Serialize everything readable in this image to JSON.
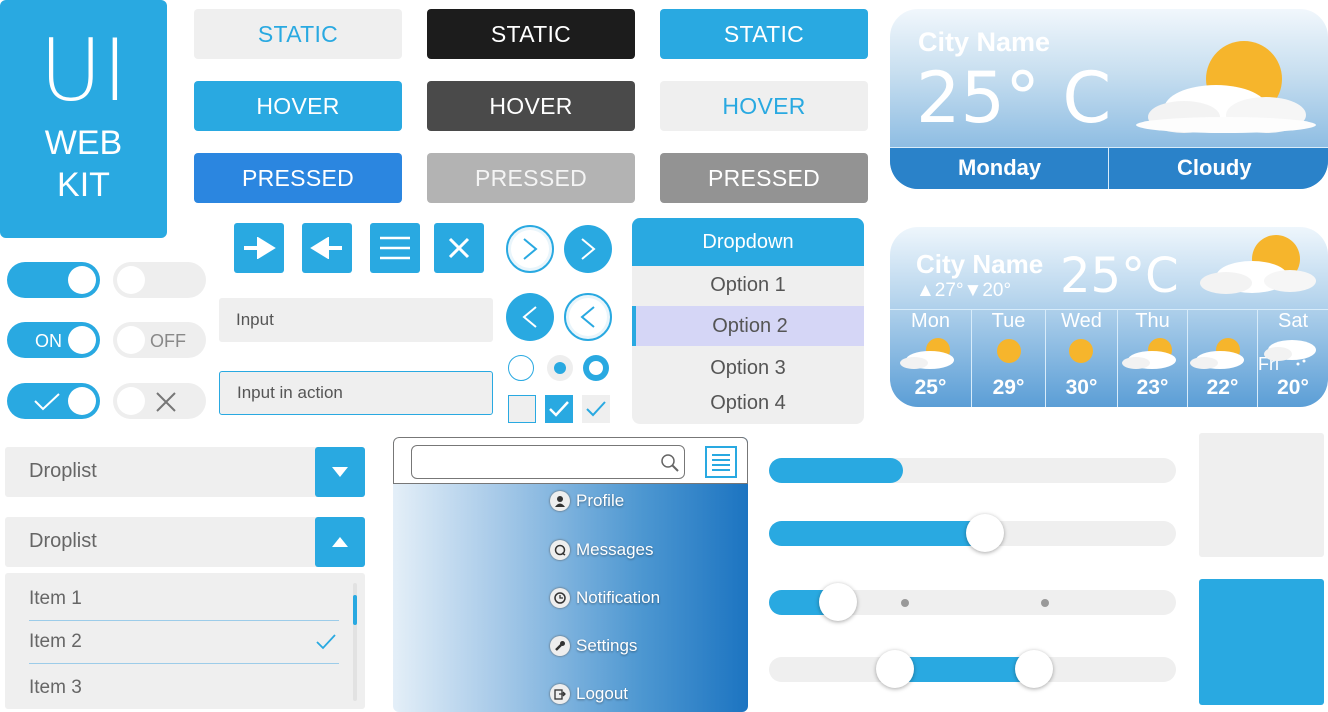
{
  "logo": {
    "line1": "UI",
    "line2": "WEB",
    "line3": "KIT"
  },
  "buttons": {
    "static": [
      "STATIC",
      "STATIC",
      "STATIC"
    ],
    "hover": [
      "HOVER",
      "HOVER",
      "HOVER"
    ],
    "pressed": [
      "PRESSED",
      "PRESSED",
      "PRESSED"
    ]
  },
  "toggles": {
    "on_label": "ON",
    "off_label": "OFF"
  },
  "inputs": {
    "input": "Input",
    "input_active": "Input in action"
  },
  "dropdown": {
    "header": "Dropdown",
    "options": [
      "Option 1",
      "Option 2",
      "Option 3",
      "Option 4"
    ],
    "selected": "Option 2"
  },
  "weather_main": {
    "city": "City Name",
    "temp": "25° C",
    "day": "Monday",
    "condition": "Cloudy"
  },
  "weather_week": {
    "city": "City Name",
    "high_low": "▲27°▼20°",
    "temp": "25°C",
    "days": [
      {
        "name": "Mon",
        "temp": "25°",
        "icon": "partly-cloudy-icon"
      },
      {
        "name": "Tue",
        "temp": "29°",
        "icon": "sun-icon"
      },
      {
        "name": "Wed",
        "temp": "30°",
        "icon": "sun-icon"
      },
      {
        "name": "Thu",
        "temp": "23°",
        "icon": "partly-cloudy-icon"
      },
      {
        "name": "Fri",
        "temp": "22°",
        "icon": "partly-cloudy-icon"
      },
      {
        "name": "Sat",
        "temp": "20°",
        "icon": "snow-cloud-icon"
      }
    ]
  },
  "droplists": {
    "closed_label": "Droplist",
    "open_label": "Droplist",
    "items": [
      "Item 1",
      "Item 2",
      "Item 3"
    ],
    "checked": "Item 2"
  },
  "menu": {
    "items": [
      "Profile",
      "Messages",
      "Notification",
      "Settings",
      "Logout"
    ]
  },
  "sliders": {
    "progress": 0.33,
    "single": 0.53,
    "stepped": 0.17,
    "range": [
      0.31,
      0.65
    ]
  },
  "colors": {
    "accent": "#29a9e1",
    "pressed": "#2b86e0",
    "light": "#efefef",
    "dark": "#1c1c1c"
  }
}
